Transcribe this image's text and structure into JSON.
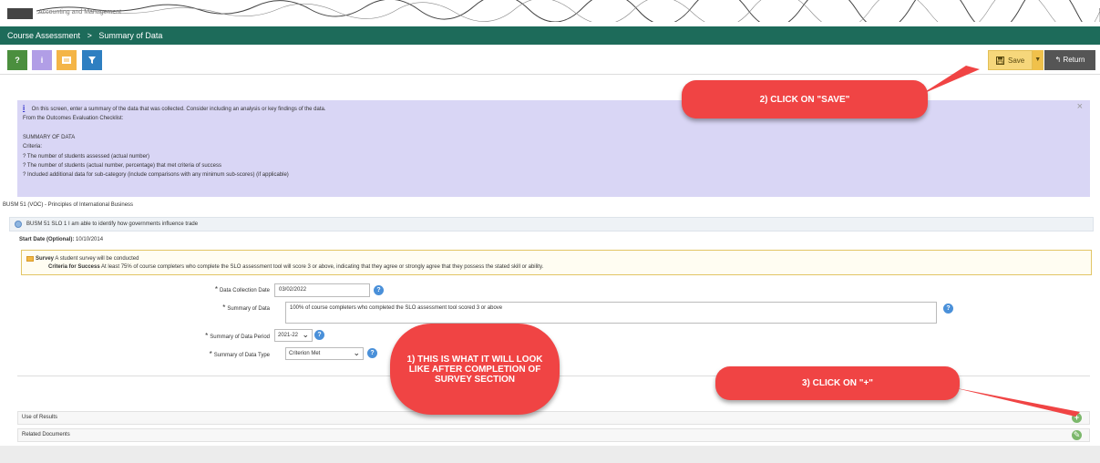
{
  "header": {
    "app_label": "Accounting and Management"
  },
  "breadcrumb": {
    "item1": "Course Assessment",
    "separator": ">",
    "item2": "Summary of Data"
  },
  "toolbar": {
    "help_label": "?",
    "info_label": "i",
    "save_label": "Save",
    "return_label": "Return",
    "colors": {
      "help": "#4b8f3e",
      "info": "#b19ee6",
      "note": "#f4b547",
      "filter": "#2e7fc1"
    }
  },
  "info": {
    "intro": "On this screen, enter a summary of the data that was collected. Consider including an analysis or key findings of the data.",
    "from": "From the Outcomes Evaluation Checklist:",
    "heading": "SUMMARY OF DATA",
    "criteria_label": "Criteria:",
    "items": [
      "? The number of students assessed (actual number)",
      "? The number of students (actual number, percentage) that met criteria of success",
      "? Included additional data for sub-category (include comparisons with any minimum sub-scores) (if applicable)"
    ]
  },
  "course": {
    "title": "BUSM 51 (VOC) - Principles of International Business"
  },
  "slo": {
    "label": "BUSM 51 SLO 1 I am able to identify how governments influence trade"
  },
  "start_date": {
    "label": "Start Date (Optional):",
    "value": "10/10/2014"
  },
  "survey": {
    "label": "Survey",
    "text": "A student survey will be conducted",
    "criteria_label": "Criteria for Success",
    "criteria_text": "At least 75% of course completers who complete the SLO assessment tool will score 3 or above, indicating that they agree or strongly agree that they possess the stated skill or ability."
  },
  "form": {
    "collection_date_label": "Data Collection Date",
    "collection_date_value": "03/02/2022",
    "summary_label": "Summary of Data",
    "summary_value": "100% of course completers who completed the SLO assessment tool scored 3 or above",
    "period_label": "Summary of Data Period",
    "period_value": "2021-22",
    "type_label": "Summary of Data Type",
    "type_value": "Criterion Met"
  },
  "sections": {
    "use_of_results": "Use of Results",
    "related_documents": "Related Documents"
  },
  "callouts": {
    "one": "1) THIS IS WHAT IT WILL LOOK LIKE AFTER COMPLETION OF SURVEY SECTION",
    "two": "2) CLICK ON \"SAVE\"",
    "three": "3) CLICK ON \"+\""
  }
}
